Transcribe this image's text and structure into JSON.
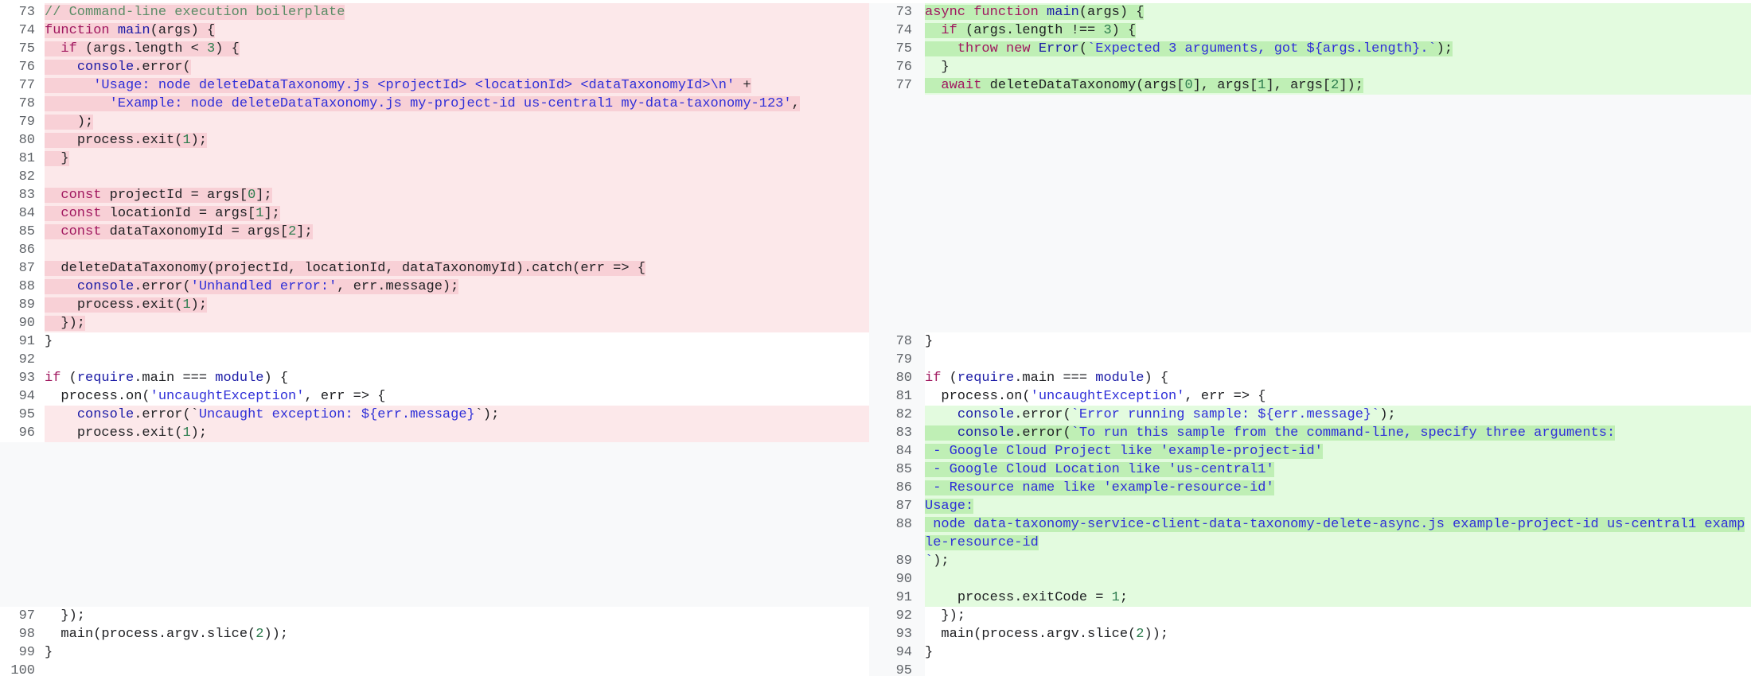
{
  "colors": {
    "deleted_line": "#fce8ea",
    "deleted_word": "#f8d0d6",
    "added_line": "#e3fbdf",
    "added_word": "#bfefb5"
  },
  "left": {
    "rows": [
      {
        "num": "73",
        "kind": "del",
        "hl": true,
        "t": [
          [
            "// Command-line execution boilerplate",
            "c"
          ]
        ]
      },
      {
        "num": "74",
        "kind": "del",
        "hl": true,
        "t": [
          [
            "function ",
            "k"
          ],
          [
            "main",
            "f"
          ],
          [
            "(args) {",
            ""
          ]
        ]
      },
      {
        "num": "75",
        "kind": "del",
        "hl": true,
        "t": [
          [
            "  ",
            ""
          ],
          [
            "if",
            "k"
          ],
          [
            " (args.length < ",
            ""
          ],
          [
            "3",
            "n"
          ],
          [
            ") {",
            ""
          ]
        ]
      },
      {
        "num": "76",
        "kind": "del",
        "hl": true,
        "t": [
          [
            "    ",
            ""
          ],
          [
            "console",
            "f"
          ],
          [
            ".error(",
            ""
          ]
        ]
      },
      {
        "num": "77",
        "kind": "del",
        "hl": true,
        "t": [
          [
            "      ",
            ""
          ],
          [
            "'Usage: node deleteDataTaxonomy.js <projectId> <locationId> <dataTaxonomyId>\\n'",
            "s"
          ],
          [
            " +",
            ""
          ]
        ]
      },
      {
        "num": "78",
        "kind": "del",
        "hl": true,
        "t": [
          [
            "        ",
            ""
          ],
          [
            "'Example: node deleteDataTaxonomy.js my-project-id us-central1 my-data-taxonomy-123'",
            "s"
          ],
          [
            ",",
            ""
          ]
        ]
      },
      {
        "num": "79",
        "kind": "del",
        "hl": true,
        "t": [
          [
            "    );",
            ""
          ]
        ]
      },
      {
        "num": "80",
        "kind": "del",
        "hl": true,
        "t": [
          [
            "    process.exit(",
            ""
          ],
          [
            "1",
            "n"
          ],
          [
            ");",
            ""
          ]
        ]
      },
      {
        "num": "81",
        "kind": "del",
        "hl": true,
        "t": [
          [
            "  }",
            ""
          ]
        ]
      },
      {
        "num": "82",
        "kind": "del",
        "t": []
      },
      {
        "num": "83",
        "kind": "del",
        "hl": true,
        "t": [
          [
            "  ",
            ""
          ],
          [
            "const ",
            "k"
          ],
          [
            "projectId = args[",
            ""
          ],
          [
            "0",
            "n"
          ],
          [
            "];",
            ""
          ]
        ]
      },
      {
        "num": "84",
        "kind": "del",
        "hl": true,
        "t": [
          [
            "  ",
            ""
          ],
          [
            "const ",
            "k"
          ],
          [
            "locationId = args[",
            ""
          ],
          [
            "1",
            "n"
          ],
          [
            "];",
            ""
          ]
        ]
      },
      {
        "num": "85",
        "kind": "del",
        "hl": true,
        "t": [
          [
            "  ",
            ""
          ],
          [
            "const ",
            "k"
          ],
          [
            "dataTaxonomyId = args[",
            ""
          ],
          [
            "2",
            "n"
          ],
          [
            "];",
            ""
          ]
        ]
      },
      {
        "num": "86",
        "kind": "del",
        "t": []
      },
      {
        "num": "87",
        "kind": "del",
        "hl": true,
        "t": [
          [
            "  deleteDataTaxonomy(projectId, locationId, dataTaxonomyId).catch(err => {",
            ""
          ]
        ]
      },
      {
        "num": "88",
        "kind": "del",
        "hl": true,
        "t": [
          [
            "    ",
            ""
          ],
          [
            "console",
            "f"
          ],
          [
            ".error(",
            ""
          ],
          [
            "'Unhandled error:'",
            "s"
          ],
          [
            ", err.message);",
            ""
          ]
        ]
      },
      {
        "num": "89",
        "kind": "del",
        "hl": true,
        "t": [
          [
            "    process.exit(",
            ""
          ],
          [
            "1",
            "n"
          ],
          [
            ");",
            ""
          ]
        ]
      },
      {
        "num": "90",
        "kind": "del",
        "hl": true,
        "t": [
          [
            "  });",
            ""
          ]
        ]
      },
      {
        "num": "91",
        "t": [
          [
            "}",
            ""
          ]
        ]
      },
      {
        "num": "92",
        "t": []
      },
      {
        "num": "93",
        "t": [
          [
            "if",
            "k"
          ],
          [
            " (",
            ""
          ],
          [
            "require",
            "f"
          ],
          [
            ".main === ",
            ""
          ],
          [
            "module",
            "f"
          ],
          [
            ") {",
            ""
          ]
        ]
      },
      {
        "num": "94",
        "t": [
          [
            "  process.on(",
            ""
          ],
          [
            "'uncaughtException'",
            "s"
          ],
          [
            ", err => {",
            ""
          ]
        ]
      },
      {
        "num": "95",
        "kind": "del",
        "t": [
          [
            "    ",
            ""
          ],
          [
            "console",
            "f"
          ],
          [
            ".error(`",
            ""
          ],
          [
            "Uncaught exception: ${err.message}",
            "s h"
          ],
          [
            "`);",
            ""
          ]
        ]
      },
      {
        "num": "96",
        "kind": "del",
        "t": [
          [
            "    process.exit",
            ""
          ],
          [
            "(",
            "h"
          ],
          [
            "1",
            "n h"
          ],
          [
            ");",
            ""
          ]
        ]
      },
      {
        "gap": 9
      },
      {
        "num": "97",
        "t": [
          [
            "  });",
            ""
          ]
        ]
      },
      {
        "num": "98",
        "t": [
          [
            "  main(process.argv.slice(",
            ""
          ],
          [
            "2",
            "n"
          ],
          [
            "));",
            ""
          ]
        ]
      },
      {
        "num": "99",
        "t": [
          [
            "}",
            ""
          ]
        ]
      },
      {
        "num": "100",
        "t": []
      }
    ]
  },
  "right": {
    "rows": [
      {
        "num": "73",
        "kind": "add",
        "hl": true,
        "t": [
          [
            "async function ",
            "k"
          ],
          [
            "main",
            "f"
          ],
          [
            "(args) {",
            ""
          ]
        ]
      },
      {
        "num": "74",
        "kind": "add",
        "hl": true,
        "t": [
          [
            "  ",
            ""
          ],
          [
            "if",
            "k"
          ],
          [
            " (args.length !== ",
            ""
          ],
          [
            "3",
            "n"
          ],
          [
            ") {",
            ""
          ]
        ]
      },
      {
        "num": "75",
        "kind": "add",
        "hl": true,
        "t": [
          [
            "    ",
            ""
          ],
          [
            "throw new ",
            "k"
          ],
          [
            "Error",
            "f"
          ],
          [
            "(",
            ""
          ],
          [
            "`Expected 3 arguments, got ${args.length}.`",
            "s"
          ],
          [
            ");",
            ""
          ]
        ]
      },
      {
        "num": "76",
        "kind": "add",
        "t": [
          [
            "  }",
            ""
          ]
        ]
      },
      {
        "num": "77",
        "kind": "add",
        "hl": true,
        "t": [
          [
            "  ",
            ""
          ],
          [
            "await ",
            "k"
          ],
          [
            "deleteDataTaxonomy(args[",
            ""
          ],
          [
            "0",
            "n"
          ],
          [
            "], args[",
            ""
          ],
          [
            "1",
            "n"
          ],
          [
            "], args[",
            ""
          ],
          [
            "2",
            "n"
          ],
          [
            "]);",
            ""
          ]
        ]
      },
      {
        "gap": 13
      },
      {
        "num": "78",
        "t": [
          [
            "}",
            ""
          ]
        ]
      },
      {
        "num": "79",
        "t": []
      },
      {
        "num": "80",
        "t": [
          [
            "if",
            "k"
          ],
          [
            " (",
            ""
          ],
          [
            "require",
            "f"
          ],
          [
            ".main === ",
            ""
          ],
          [
            "module",
            "f"
          ],
          [
            ") {",
            ""
          ]
        ]
      },
      {
        "num": "81",
        "t": [
          [
            "  process.on(",
            ""
          ],
          [
            "'uncaughtException'",
            "s"
          ],
          [
            ", err => {",
            ""
          ]
        ]
      },
      {
        "num": "82",
        "kind": "add",
        "t": [
          [
            "    ",
            ""
          ],
          [
            "console",
            "f"
          ],
          [
            ".error(",
            ""
          ],
          [
            "`Error running sample: ${err.message}`",
            "s h"
          ],
          [
            ");",
            "h"
          ]
        ]
      },
      {
        "num": "83",
        "kind": "add",
        "hl": true,
        "t": [
          [
            "    ",
            ""
          ],
          [
            "console",
            "f"
          ],
          [
            ".error(",
            ""
          ],
          [
            "`To run this sample from the command-line, specify three arguments:",
            "s"
          ]
        ]
      },
      {
        "num": "84",
        "kind": "add",
        "hl": true,
        "t": [
          [
            " - Google Cloud Project like 'example-project-id'",
            "s"
          ]
        ]
      },
      {
        "num": "85",
        "kind": "add",
        "hl": true,
        "t": [
          [
            " - Google Cloud Location like 'us-central1'",
            "s"
          ]
        ]
      },
      {
        "num": "86",
        "kind": "add",
        "hl": true,
        "t": [
          [
            " - Resource name like 'example-resource-id'",
            "s"
          ]
        ]
      },
      {
        "num": "87",
        "kind": "add",
        "hl": true,
        "t": [
          [
            "Usage:",
            "s"
          ]
        ]
      },
      {
        "num": "88",
        "kind": "add",
        "hl": true,
        "t": [
          [
            " node data-taxonomy-service-client-data-taxonomy-delete-async.js example-project-id us-central1 example-resource-id",
            "s"
          ]
        ]
      },
      {
        "num": "89",
        "kind": "add",
        "t": [
          [
            "`",
            "s"
          ],
          [
            ");",
            ""
          ]
        ]
      },
      {
        "num": "90",
        "kind": "add",
        "t": []
      },
      {
        "num": "91",
        "kind": "add",
        "t": [
          [
            "    process.exit",
            ""
          ],
          [
            "Code = ",
            "h"
          ],
          [
            "1",
            "n h"
          ],
          [
            ";",
            ""
          ]
        ]
      },
      {
        "num": "92",
        "t": [
          [
            "  });",
            ""
          ]
        ]
      },
      {
        "num": "93",
        "t": [
          [
            "  main(process.argv.slice(",
            ""
          ],
          [
            "2",
            "n"
          ],
          [
            "));",
            ""
          ]
        ]
      },
      {
        "num": "94",
        "t": [
          [
            "}",
            ""
          ]
        ]
      },
      {
        "num": "95",
        "t": []
      }
    ]
  }
}
